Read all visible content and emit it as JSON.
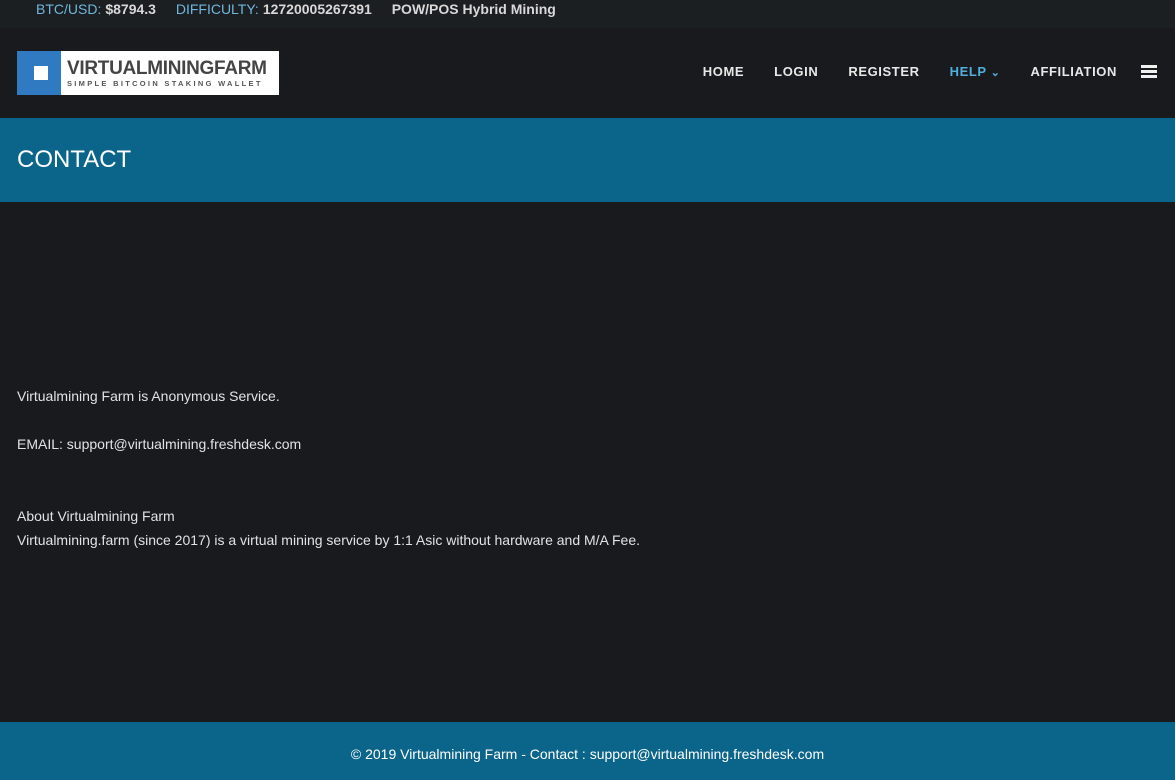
{
  "topbar": {
    "btc_label": "BTC/USD:",
    "btc_value": "$8794.3",
    "difficulty_label": "DIFFICULTY:",
    "difficulty_value": "12720005267391",
    "tagline": "POW/POS Hybrid Mining"
  },
  "logo": {
    "title": "VIRTUALMININGFARM",
    "subtitle": "SIMPLE BITCOIN STAKING WALLET"
  },
  "nav": {
    "items": [
      {
        "label": "HOME"
      },
      {
        "label": "LOGIN"
      },
      {
        "label": "REGISTER"
      },
      {
        "label": "HELP"
      },
      {
        "label": "AFFILIATION"
      }
    ],
    "help_chevron": "⌄"
  },
  "page": {
    "title": "CONTACT"
  },
  "content": {
    "line1": "Virtualmining Farm is Anonymous Service.",
    "email": "EMAIL: support@virtualmining.freshdesk.com",
    "about_title": "About Virtualmining Farm",
    "about_text": "Virtualmining.farm (since 2017) is a virtual mining service by 1:1 Asic without hardware and M/A Fee."
  },
  "footer": {
    "text": "© 2019 Virtualmining Farm - Contact : support@virtualmining.freshdesk.com"
  }
}
